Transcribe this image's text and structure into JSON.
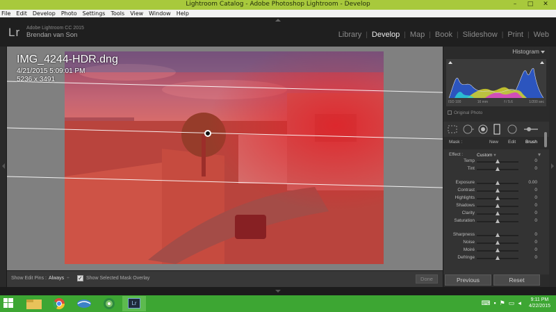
{
  "window": {
    "title": "Lightroom Catalog - Adobe Photoshop Lightroom - Develop",
    "min": "–",
    "max": "□",
    "close": "✕"
  },
  "menu": [
    "File",
    "Edit",
    "Develop",
    "Photo",
    "Settings",
    "Tools",
    "View",
    "Window",
    "Help"
  ],
  "identity": {
    "logo": "Lr",
    "version": "Adobe Lightroom CC 2015",
    "user": "Brendan van Son"
  },
  "modules": [
    {
      "label": "Library",
      "active": false
    },
    {
      "label": "Develop",
      "active": true
    },
    {
      "label": "Map",
      "active": false
    },
    {
      "label": "Book",
      "active": false
    },
    {
      "label": "Slideshow",
      "active": false
    },
    {
      "label": "Print",
      "active": false
    },
    {
      "label": "Web",
      "active": false
    }
  ],
  "photo": {
    "filename": "IMG_4244-HDR.dng",
    "datetime": "4/21/2015 5:09:01 PM",
    "dimensions": "5236 x 3491"
  },
  "toolbar": {
    "show_pins_label": "Show Edit Pins :",
    "show_pins_value": "Always",
    "show_pins_arrow": "÷",
    "overlay_label": "Show Selected Mask Overlay",
    "overlay_checked": true,
    "done_label": "Done"
  },
  "histogram": {
    "title": "Histogram",
    "iso": "ISO 100",
    "focal": "16 mm",
    "aperture": "f / 5.6",
    "shutter": "1/200 sec",
    "original_photo": "Original Photo"
  },
  "mask": {
    "label": "Mask :",
    "new": "New",
    "edit": "Edit",
    "brush": "Brush"
  },
  "effect": {
    "label": "Effect :",
    "value": "Custom"
  },
  "sliders": [
    {
      "name": "Temp",
      "value": "0",
      "pos": 0.5
    },
    {
      "name": "Tint",
      "value": "0",
      "pos": 0.5
    },
    {
      "name": "Exposure",
      "value": "0.00",
      "pos": 0.5
    },
    {
      "name": "Contrast",
      "value": "0",
      "pos": 0.5
    },
    {
      "name": "Highlights",
      "value": "0",
      "pos": 0.5
    },
    {
      "name": "Shadows",
      "value": "0",
      "pos": 0.5
    },
    {
      "name": "Clarity",
      "value": "0",
      "pos": 0.5
    },
    {
      "name": "Saturation",
      "value": "0",
      "pos": 0.5
    },
    {
      "name": "Sharpness",
      "value": "0",
      "pos": 0.5
    },
    {
      "name": "Noise",
      "value": "0",
      "pos": 0.5
    },
    {
      "name": "Moiré",
      "value": "0",
      "pos": 0.5
    },
    {
      "name": "Defringe",
      "value": "0",
      "pos": 0.5
    }
  ],
  "buttons": {
    "previous": "Previous",
    "reset": "Reset"
  },
  "taskbar": {
    "time": "9:11 PM",
    "date": "4/22/2015"
  },
  "colors": {
    "mask_overlay": "#e0242a",
    "titlebar": "#a8c93c",
    "taskbar": "#3da633"
  }
}
